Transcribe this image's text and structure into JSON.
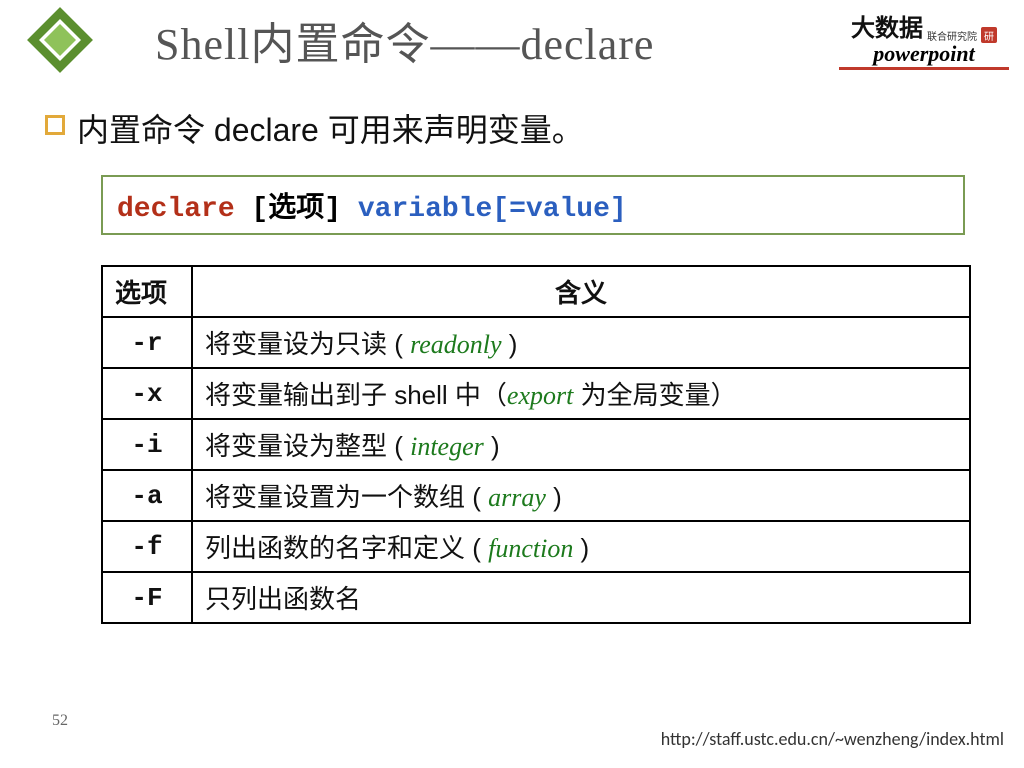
{
  "header": {
    "title": "Shell内置命令——declare"
  },
  "brand": {
    "cn_big": "大数据",
    "cn_small": "联合研究院",
    "en": "powerpoint"
  },
  "bullet": "内置命令 declare 可用来声明变量。",
  "syntax": {
    "keyword": "declare",
    "bracket_open": " [",
    "option_word": "选项",
    "bracket_close": "] ",
    "var_part": "variable[=value]"
  },
  "table": {
    "head_option": "选项",
    "head_meaning": "含义",
    "rows": [
      {
        "flag": "-r",
        "pre": "将变量设为只读 ( ",
        "it": "readonly",
        "post": " )"
      },
      {
        "flag": "-x",
        "pre": "将变量输出到子 shell 中（",
        "it": "export",
        "post": " 为全局变量）"
      },
      {
        "flag": "-i",
        "pre": "将变量设为整型 ( ",
        "it": "integer",
        "post": " )"
      },
      {
        "flag": "-a",
        "pre": "将变量设置为一个数组 ( ",
        "it": "array",
        "post": " )"
      },
      {
        "flag": "-f",
        "pre": "列出函数的名字和定义 ( ",
        "it": "function",
        "post": " )"
      },
      {
        "flag": "-F",
        "pre": "只列出函数名",
        "it": "",
        "post": ""
      }
    ]
  },
  "page_number": "52",
  "footer_url": "http://staff.ustc.edu.cn/~wenzheng/index.html"
}
